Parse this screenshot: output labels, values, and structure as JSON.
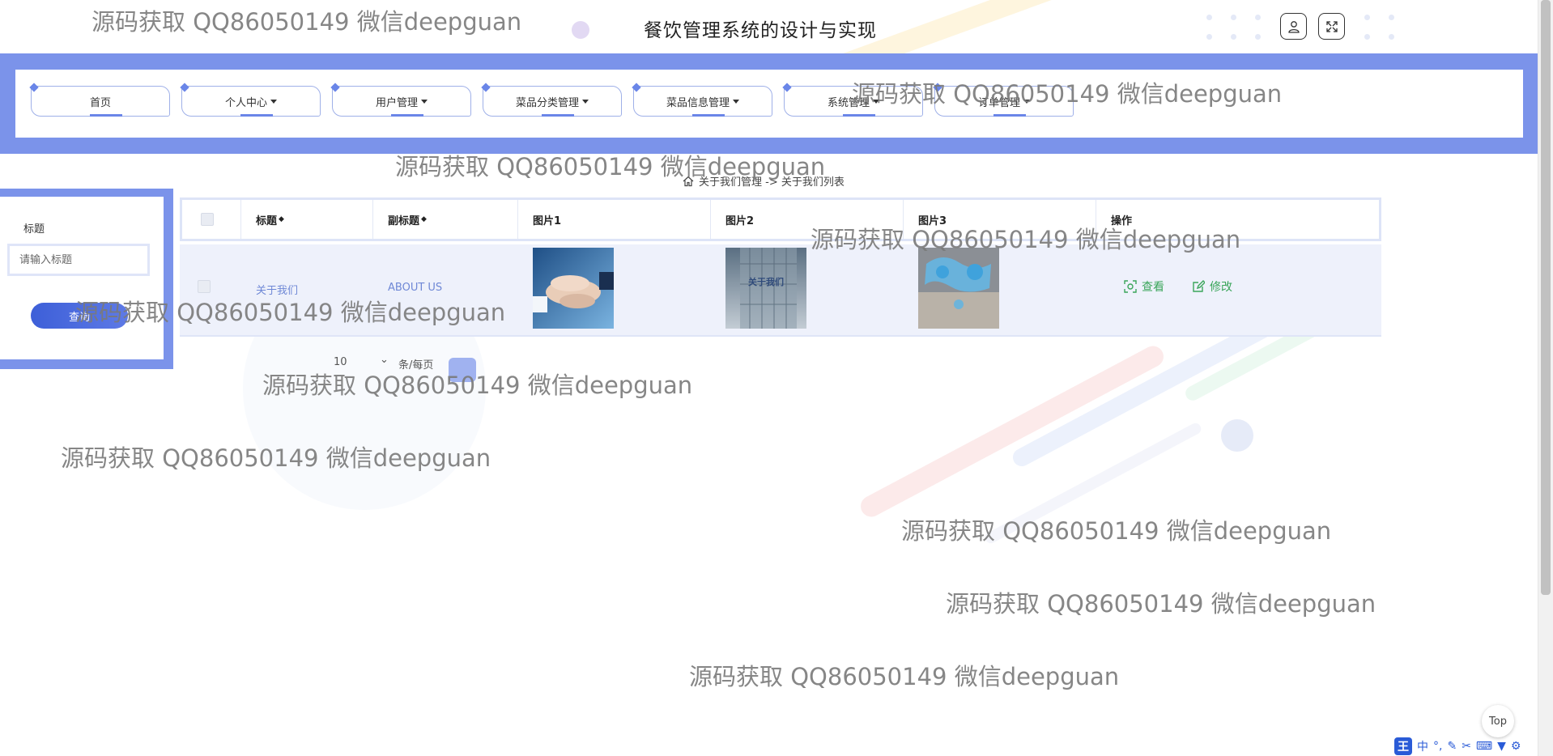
{
  "header": {
    "title": "餐饮管理系统的设计与实现",
    "user_icon": "user-icon",
    "fullscreen_icon": "fullscreen-icon"
  },
  "nav": {
    "items": [
      {
        "label": "首页"
      },
      {
        "label": "个人中心"
      },
      {
        "label": "用户管理"
      },
      {
        "label": "菜品分类管理"
      },
      {
        "label": "菜品信息管理"
      },
      {
        "label": "系统管理"
      },
      {
        "label": "订单管理"
      }
    ]
  },
  "breadcrumb": {
    "text": "关于我们管理 -> 关于我们列表",
    "icon": "home-icon"
  },
  "search": {
    "label": "标题",
    "placeholder": "请输入标题",
    "button_label": "查询"
  },
  "table": {
    "columns": [
      "标题",
      "副标题",
      "图片1",
      "图片2",
      "图片3",
      "操作"
    ],
    "rows": [
      {
        "title": "关于我们",
        "subtitle": "ABOUT US",
        "image2_caption": "关于我们",
        "actions": [
          "查看",
          "修改"
        ]
      }
    ]
  },
  "pagination": {
    "page_size": "10",
    "page_size_suffix": "条/每页"
  },
  "watermark": "源码获取 QQ86050149 微信deepguan",
  "scroll_top_label": "Top",
  "ime_toolbar": {
    "logo": "王",
    "mode": "中"
  },
  "colors": {
    "accent": "#7b93ea",
    "action_green": "#3aa55a",
    "link_blue": "#6f88d6"
  }
}
